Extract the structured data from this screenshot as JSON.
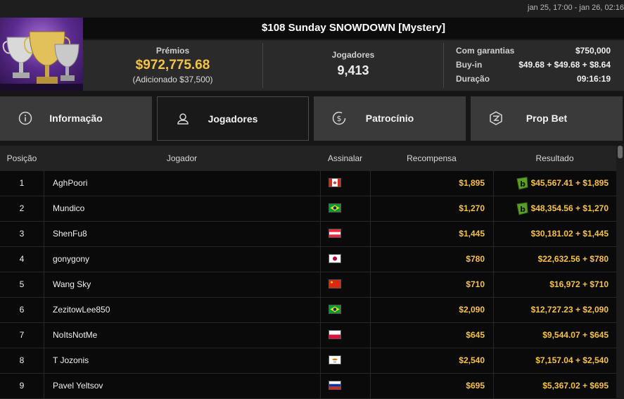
{
  "header": {
    "date_range": "jan 25, 17:00 - jan 26, 02:16",
    "title": "$108 Sunday SNOWDOWN [Mystery]"
  },
  "info": {
    "prizes_label": "Prémios",
    "prizes_value": "$972,775.68",
    "added": "(Adicionado $37,500)",
    "players_label": "Jogadores",
    "players_value": "9,413",
    "guarantee_label": "Com garantias",
    "guarantee_value": "$750,000",
    "buyin_label": "Buy-in",
    "buyin_value": "$49.68 + $49.68 + $8.64",
    "duration_label": "Duração",
    "duration_value": "09:16:19"
  },
  "tabs": [
    {
      "label": "Informação",
      "icon": "info-icon",
      "active": false
    },
    {
      "label": "Jogadores",
      "icon": "user-icon",
      "active": true
    },
    {
      "label": "Patrocínio",
      "icon": "sponsor-icon",
      "active": false
    },
    {
      "label": "Prop Bet",
      "icon": "prop-bet-icon",
      "active": false
    }
  ],
  "table": {
    "headers": [
      "Posição",
      "Jogador",
      "Assinalar",
      "Recompensa",
      "Resultado"
    ],
    "rows": [
      {
        "pos": "1",
        "name": "AghPoori",
        "flag": "canada",
        "reward": "$1,895",
        "result": "$45,567.41 + $1,895",
        "badge": true
      },
      {
        "pos": "2",
        "name": "Mundico",
        "flag": "brazil",
        "reward": "$1,270",
        "result": "$48,354.56 + $1,270",
        "badge": true
      },
      {
        "pos": "3",
        "name": "ShenFu8",
        "flag": "austria",
        "reward": "$1,445",
        "result": "$30,181.02 + $1,445",
        "badge": false
      },
      {
        "pos": "4",
        "name": "gonygony",
        "flag": "japan",
        "reward": "$780",
        "result": "$22,632.56 + $780",
        "badge": false
      },
      {
        "pos": "5",
        "name": "Wang Sky",
        "flag": "china",
        "reward": "$710",
        "result": "$16,972 + $710",
        "badge": false
      },
      {
        "pos": "6",
        "name": "ZezitowLee850",
        "flag": "brazil",
        "reward": "$2,090",
        "result": "$12,727.23 + $2,090",
        "badge": false
      },
      {
        "pos": "7",
        "name": "NoItsNotMe",
        "flag": "poland",
        "reward": "$645",
        "result": "$9,544.07 + $645",
        "badge": false
      },
      {
        "pos": "8",
        "name": "T Jozonis",
        "flag": "cyprus",
        "reward": "$2,540",
        "result": "$7,157.04 + $2,540",
        "badge": false
      },
      {
        "pos": "9",
        "name": "Pavel Yeltsov",
        "flag": "russia",
        "reward": "$695",
        "result": "$5,367.02 + $695",
        "badge": false
      }
    ]
  },
  "colors": {
    "accent_gold": "#f6c247",
    "badge_green": "#5a9e2b"
  }
}
